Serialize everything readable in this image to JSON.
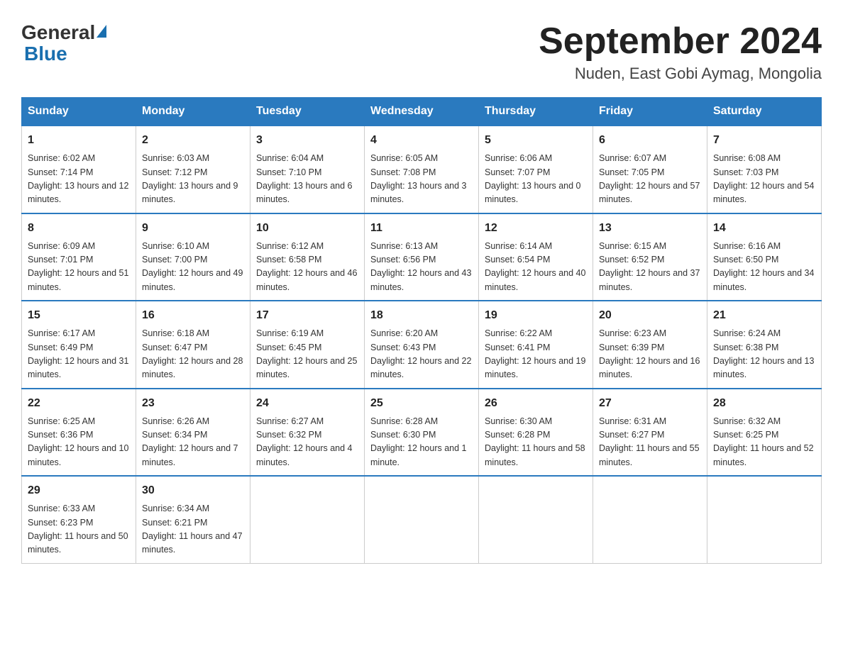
{
  "header": {
    "logo_general": "General",
    "logo_blue": "Blue",
    "month_year": "September 2024",
    "location": "Nuden, East Gobi Aymag, Mongolia"
  },
  "days_of_week": [
    "Sunday",
    "Monday",
    "Tuesday",
    "Wednesday",
    "Thursday",
    "Friday",
    "Saturday"
  ],
  "weeks": [
    [
      {
        "day": "1",
        "sunrise": "Sunrise: 6:02 AM",
        "sunset": "Sunset: 7:14 PM",
        "daylight": "Daylight: 13 hours and 12 minutes."
      },
      {
        "day": "2",
        "sunrise": "Sunrise: 6:03 AM",
        "sunset": "Sunset: 7:12 PM",
        "daylight": "Daylight: 13 hours and 9 minutes."
      },
      {
        "day": "3",
        "sunrise": "Sunrise: 6:04 AM",
        "sunset": "Sunset: 7:10 PM",
        "daylight": "Daylight: 13 hours and 6 minutes."
      },
      {
        "day": "4",
        "sunrise": "Sunrise: 6:05 AM",
        "sunset": "Sunset: 7:08 PM",
        "daylight": "Daylight: 13 hours and 3 minutes."
      },
      {
        "day": "5",
        "sunrise": "Sunrise: 6:06 AM",
        "sunset": "Sunset: 7:07 PM",
        "daylight": "Daylight: 13 hours and 0 minutes."
      },
      {
        "day": "6",
        "sunrise": "Sunrise: 6:07 AM",
        "sunset": "Sunset: 7:05 PM",
        "daylight": "Daylight: 12 hours and 57 minutes."
      },
      {
        "day": "7",
        "sunrise": "Sunrise: 6:08 AM",
        "sunset": "Sunset: 7:03 PM",
        "daylight": "Daylight: 12 hours and 54 minutes."
      }
    ],
    [
      {
        "day": "8",
        "sunrise": "Sunrise: 6:09 AM",
        "sunset": "Sunset: 7:01 PM",
        "daylight": "Daylight: 12 hours and 51 minutes."
      },
      {
        "day": "9",
        "sunrise": "Sunrise: 6:10 AM",
        "sunset": "Sunset: 7:00 PM",
        "daylight": "Daylight: 12 hours and 49 minutes."
      },
      {
        "day": "10",
        "sunrise": "Sunrise: 6:12 AM",
        "sunset": "Sunset: 6:58 PM",
        "daylight": "Daylight: 12 hours and 46 minutes."
      },
      {
        "day": "11",
        "sunrise": "Sunrise: 6:13 AM",
        "sunset": "Sunset: 6:56 PM",
        "daylight": "Daylight: 12 hours and 43 minutes."
      },
      {
        "day": "12",
        "sunrise": "Sunrise: 6:14 AM",
        "sunset": "Sunset: 6:54 PM",
        "daylight": "Daylight: 12 hours and 40 minutes."
      },
      {
        "day": "13",
        "sunrise": "Sunrise: 6:15 AM",
        "sunset": "Sunset: 6:52 PM",
        "daylight": "Daylight: 12 hours and 37 minutes."
      },
      {
        "day": "14",
        "sunrise": "Sunrise: 6:16 AM",
        "sunset": "Sunset: 6:50 PM",
        "daylight": "Daylight: 12 hours and 34 minutes."
      }
    ],
    [
      {
        "day": "15",
        "sunrise": "Sunrise: 6:17 AM",
        "sunset": "Sunset: 6:49 PM",
        "daylight": "Daylight: 12 hours and 31 minutes."
      },
      {
        "day": "16",
        "sunrise": "Sunrise: 6:18 AM",
        "sunset": "Sunset: 6:47 PM",
        "daylight": "Daylight: 12 hours and 28 minutes."
      },
      {
        "day": "17",
        "sunrise": "Sunrise: 6:19 AM",
        "sunset": "Sunset: 6:45 PM",
        "daylight": "Daylight: 12 hours and 25 minutes."
      },
      {
        "day": "18",
        "sunrise": "Sunrise: 6:20 AM",
        "sunset": "Sunset: 6:43 PM",
        "daylight": "Daylight: 12 hours and 22 minutes."
      },
      {
        "day": "19",
        "sunrise": "Sunrise: 6:22 AM",
        "sunset": "Sunset: 6:41 PM",
        "daylight": "Daylight: 12 hours and 19 minutes."
      },
      {
        "day": "20",
        "sunrise": "Sunrise: 6:23 AM",
        "sunset": "Sunset: 6:39 PM",
        "daylight": "Daylight: 12 hours and 16 minutes."
      },
      {
        "day": "21",
        "sunrise": "Sunrise: 6:24 AM",
        "sunset": "Sunset: 6:38 PM",
        "daylight": "Daylight: 12 hours and 13 minutes."
      }
    ],
    [
      {
        "day": "22",
        "sunrise": "Sunrise: 6:25 AM",
        "sunset": "Sunset: 6:36 PM",
        "daylight": "Daylight: 12 hours and 10 minutes."
      },
      {
        "day": "23",
        "sunrise": "Sunrise: 6:26 AM",
        "sunset": "Sunset: 6:34 PM",
        "daylight": "Daylight: 12 hours and 7 minutes."
      },
      {
        "day": "24",
        "sunrise": "Sunrise: 6:27 AM",
        "sunset": "Sunset: 6:32 PM",
        "daylight": "Daylight: 12 hours and 4 minutes."
      },
      {
        "day": "25",
        "sunrise": "Sunrise: 6:28 AM",
        "sunset": "Sunset: 6:30 PM",
        "daylight": "Daylight: 12 hours and 1 minute."
      },
      {
        "day": "26",
        "sunrise": "Sunrise: 6:30 AM",
        "sunset": "Sunset: 6:28 PM",
        "daylight": "Daylight: 11 hours and 58 minutes."
      },
      {
        "day": "27",
        "sunrise": "Sunrise: 6:31 AM",
        "sunset": "Sunset: 6:27 PM",
        "daylight": "Daylight: 11 hours and 55 minutes."
      },
      {
        "day": "28",
        "sunrise": "Sunrise: 6:32 AM",
        "sunset": "Sunset: 6:25 PM",
        "daylight": "Daylight: 11 hours and 52 minutes."
      }
    ],
    [
      {
        "day": "29",
        "sunrise": "Sunrise: 6:33 AM",
        "sunset": "Sunset: 6:23 PM",
        "daylight": "Daylight: 11 hours and 50 minutes."
      },
      {
        "day": "30",
        "sunrise": "Sunrise: 6:34 AM",
        "sunset": "Sunset: 6:21 PM",
        "daylight": "Daylight: 11 hours and 47 minutes."
      },
      null,
      null,
      null,
      null,
      null
    ]
  ]
}
